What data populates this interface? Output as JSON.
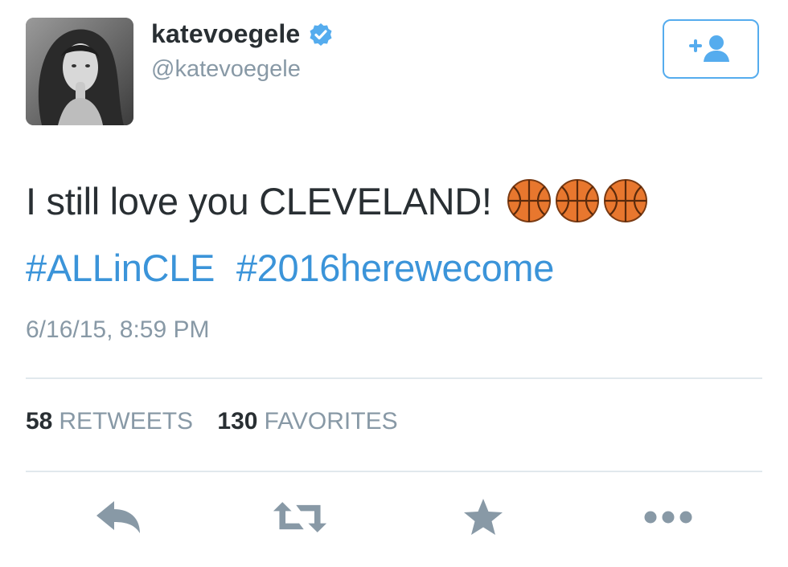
{
  "author": {
    "name": "katevoegele",
    "handle": "@katevoegele",
    "verified": true
  },
  "follow_button": {
    "icon": "add-user-icon",
    "label": "+"
  },
  "tweet": {
    "text": "I still love you CLEVELAND!",
    "emojis": [
      "basketball-emoji",
      "basketball-emoji",
      "basketball-emoji"
    ],
    "hashtags": [
      "#ALLinCLE",
      "#2016herewecome"
    ],
    "timestamp": "6/16/15, 8:59 PM"
  },
  "stats": {
    "retweets_count": "58",
    "retweets_label": "RETWEETS",
    "favorites_count": "130",
    "favorites_label": "FAVORITES"
  },
  "actions": [
    {
      "name": "reply",
      "icon": "reply-icon"
    },
    {
      "name": "retweet",
      "icon": "retweet-icon"
    },
    {
      "name": "favorite",
      "icon": "star-icon"
    },
    {
      "name": "more",
      "icon": "more-icon"
    }
  ],
  "colors": {
    "accent": "#55acee",
    "hashtag": "#3b94d9",
    "muted": "#8899a6",
    "text": "#292f33",
    "icon": "#8899a6",
    "divider": "#e1e8ed"
  }
}
